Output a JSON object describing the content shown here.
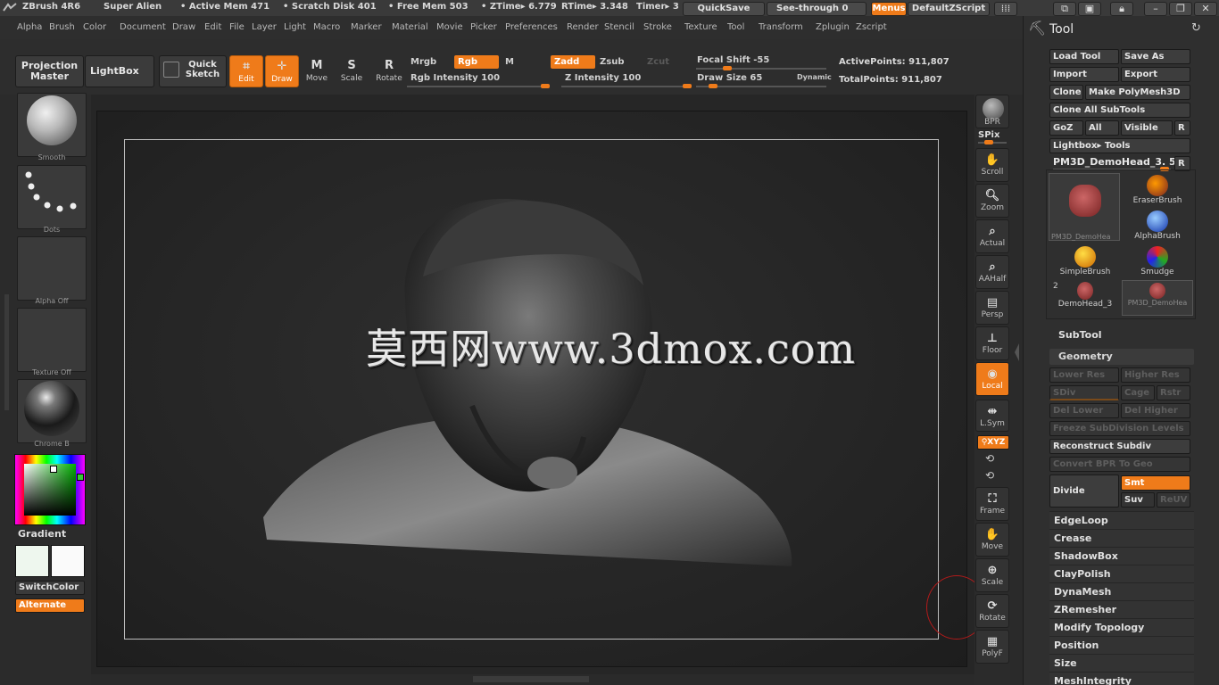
{
  "titlebar": {
    "app_title": "ZBrush 4R6",
    "theme": "Super Alien",
    "active_mem": "• Active Mem 471",
    "scratch_disk": "• Scratch Disk 401",
    "free_mem": "• Free Mem 503",
    "ztime": "• ZTime▸ 6.779",
    "rtime": "RTime▸ 3.348",
    "timer": "Timer▸ 3",
    "quicksave": "QuickSave",
    "see_through": "See-through  0",
    "menus": "Menus",
    "default_zscript": "DefaultZScript"
  },
  "menubar": {
    "items": [
      "Alpha",
      "Brush",
      "Color",
      "Document",
      "Draw",
      "Edit",
      "File",
      "Layer",
      "Light",
      "Macro",
      "Marker",
      "Material",
      "Movie",
      "Picker",
      "Preferences",
      "Render",
      "Stencil",
      "Stroke",
      "Texture",
      "Tool",
      "Transform",
      "Zplugin",
      "Zscript"
    ]
  },
  "shelf": {
    "projection_master": "Projection Master",
    "lightbox": "LightBox",
    "quick_sketch": "Quick Sketch",
    "edit": "Edit",
    "draw": "Draw",
    "move": "Move",
    "scale": "Scale",
    "rotate": "Rotate",
    "mrgb": "Mrgb",
    "rgb": "Rgb",
    "m": "M",
    "rgb_intensity": "Rgb Intensity 100",
    "zadd": "Zadd",
    "zsub": "Zsub",
    "zcut": "Zcut",
    "z_intensity": "Z Intensity 100",
    "focal_shift": "Focal Shift -55",
    "draw_size": "Draw Size 65",
    "dynamic": "Dynamic",
    "active_points": "ActivePoints: 911,807",
    "total_points": "TotalPoints: 911,807",
    "rgb_intensity_level": 1.0,
    "z_intensity_level": 1.0,
    "focal_shift_level": 0.22,
    "draw_size_level": 0.1
  },
  "lefttray": {
    "brush_label": "Smooth",
    "stroke_label": "Dots",
    "alpha_label": "Alpha Off",
    "texture_label": "Texture Off",
    "material_label": "Chrome B",
    "gradient": "Gradient",
    "switchcolor": "SwitchColor",
    "alternate": "Alternate"
  },
  "canvas": {
    "watermark": "莫西网www.3dmox.com"
  },
  "rightstrip": {
    "bpr": "BPR",
    "spix": "SPix",
    "scroll": "Scroll",
    "zoom": "Zoom",
    "actual": "Actual",
    "aahalf": "AAHalf",
    "persp": "Persp",
    "floor": "Floor",
    "local": "Local",
    "lsym": "L.Sym",
    "xyz": "⚲XYZ",
    "frame": "Frame",
    "move": "Move",
    "scale": "Scale",
    "rotate": "Rotate",
    "polyf": "PolyF"
  },
  "rightpanel": {
    "title": "Tool",
    "load_tool": "Load Tool",
    "save_as": "Save As",
    "import": "Import",
    "export": "Export",
    "clone": "Clone",
    "make_polymesh": "Make PolyMesh3D",
    "clone_all": "Clone All SubTools",
    "goz": "GoZ",
    "all": "All",
    "visible": "Visible",
    "r": "R",
    "lightbox_tools": "Lightbox▸ Tools",
    "current_tool": "PM3D_DemoHead_3. 53",
    "tools": [
      {
        "label": "PM3D_DemoHea",
        "icon": "head-icon"
      },
      {
        "label": "EraserBrush",
        "icon": "eraser-brush-icon"
      },
      {
        "label": "AlphaBrush",
        "icon": "alpha-brush-icon"
      },
      {
        "label": "SimpleBrush",
        "icon": "simple-brush-icon"
      },
      {
        "label": "Smudge",
        "icon": "smudge-icon"
      },
      {
        "label": "DemoHead_3",
        "icon": "head-icon"
      },
      {
        "label": "PM3D_DemoHea",
        "icon": "head-icon"
      }
    ],
    "tool_count": "2",
    "subtool": "SubTool",
    "geometry": "Geometry",
    "lower_res": "Lower Res",
    "higher_res": "Higher Res",
    "sdiv": "SDiv",
    "cage": "Cage",
    "rstr": "Rstr",
    "del_lower": "Del Lower",
    "del_higher": "Del Higher",
    "freeze_subdiv": "Freeze SubDivision Levels",
    "reconstruct_subdiv": "Reconstruct Subdiv",
    "convert_bpr": "Convert BPR To Geo",
    "divide": "Divide",
    "smt": "Smt",
    "suv": "Suv",
    "reuv": "ReUV",
    "sections": [
      "EdgeLoop",
      "Crease",
      "ShadowBox",
      "ClayPolish",
      "DynaMesh",
      "ZRemesher",
      "Modify Topology",
      "Position",
      "Size",
      "MeshIntegrity"
    ]
  }
}
